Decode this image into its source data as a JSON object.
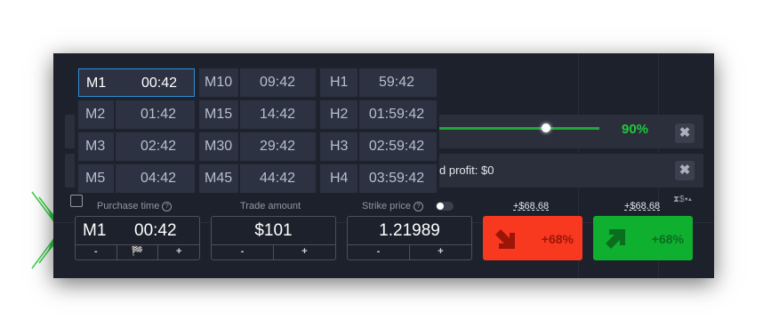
{
  "dropdown": {
    "columns": [
      [
        {
          "code": "M1",
          "time": "00:42",
          "selected": true
        },
        {
          "code": "M2",
          "time": "01:42"
        },
        {
          "code": "M3",
          "time": "02:42"
        },
        {
          "code": "M5",
          "time": "04:42"
        }
      ],
      [
        {
          "code": "M10",
          "time": "09:42"
        },
        {
          "code": "M15",
          "time": "14:42"
        },
        {
          "code": "M30",
          "time": "29:42"
        },
        {
          "code": "M45",
          "time": "44:42"
        }
      ],
      [
        {
          "code": "H1",
          "time": "59:42"
        },
        {
          "code": "H2",
          "time": "01:59:42"
        },
        {
          "code": "H3",
          "time": "02:59:42"
        },
        {
          "code": "H4",
          "time": "03:59:42"
        }
      ]
    ]
  },
  "slider": {
    "percent": "90%",
    "level": 0.64
  },
  "profit_row": {
    "text": "d profit: $0"
  },
  "close_glyph": "✖",
  "labels": {
    "purchase_time": "Purchase time",
    "trade_amount": "Trade amount",
    "strike_price": "Strike price",
    "help_glyph": "?"
  },
  "purchase_time": {
    "code": "M1",
    "time": "00:42",
    "minus": "-",
    "flag": "🏁",
    "plus": "+"
  },
  "trade_amount": {
    "value": "$101",
    "minus": "-",
    "plus": "+"
  },
  "strike_price": {
    "value": "1.21989",
    "minus": "-",
    "plus": "+"
  },
  "payouts": {
    "down": "+$68.68",
    "up": "+$68.68"
  },
  "buttons": {
    "down_percent": "+68%",
    "up_percent": "+68%"
  },
  "sort_icon": "⧗$▾▴",
  "colors": {
    "down": "#f8381f",
    "up": "#0faf30",
    "accent": "#2c8ed4",
    "green_text": "#20c93e"
  }
}
